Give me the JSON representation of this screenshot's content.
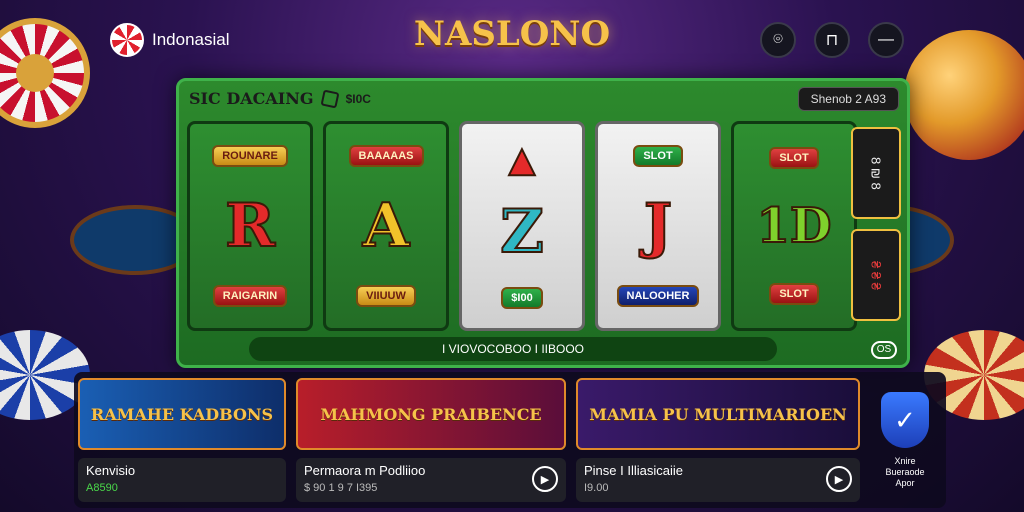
{
  "header": {
    "brand_name": "Indonasial",
    "site_title": "NASLONO",
    "actions": [
      {
        "name": "support",
        "glyph": "⌾"
      },
      {
        "name": "profile",
        "glyph": "⊓"
      },
      {
        "name": "menu",
        "glyph": "—"
      }
    ]
  },
  "slot": {
    "title": "SIC DACAING",
    "amount": "$I0C",
    "balance": "Shenob 2 A93",
    "reels": [
      {
        "top": "ROUNARE",
        "letter": "R",
        "bottom": "RAIGARIN"
      },
      {
        "top": "BAAAAAS",
        "letter": "A",
        "bottom": "VIIUUW"
      },
      {
        "top": "",
        "letter": "Z",
        "bottom": "$I00"
      },
      {
        "top": "SLOT",
        "letter": "J",
        "bottom": "NALOOHER"
      },
      {
        "top": "SLOT",
        "letter": "1D",
        "bottom": "SLOT"
      }
    ],
    "side_top": "8 ₪ 8",
    "side_bottom": "₴ ₴ ₴",
    "footer": "I VIOVOCOBOO I IIBOOO",
    "mini_logo": "OS"
  },
  "cards": [
    {
      "art": "RAMAHE KADBONS",
      "title": "Kenvisio",
      "sub": "A8590"
    },
    {
      "art": "MAHMONG PRAIBENCE",
      "title": "Permaora m Podliioo",
      "sub": "$ 90  1 9 7 I395"
    },
    {
      "art": "MAMIA PU MULTIMARIOEN",
      "title": "Pinse I Illiasicaiie",
      "sub": "I9.00"
    }
  ],
  "verify": {
    "text": "Xnire Bueraode Apor"
  }
}
